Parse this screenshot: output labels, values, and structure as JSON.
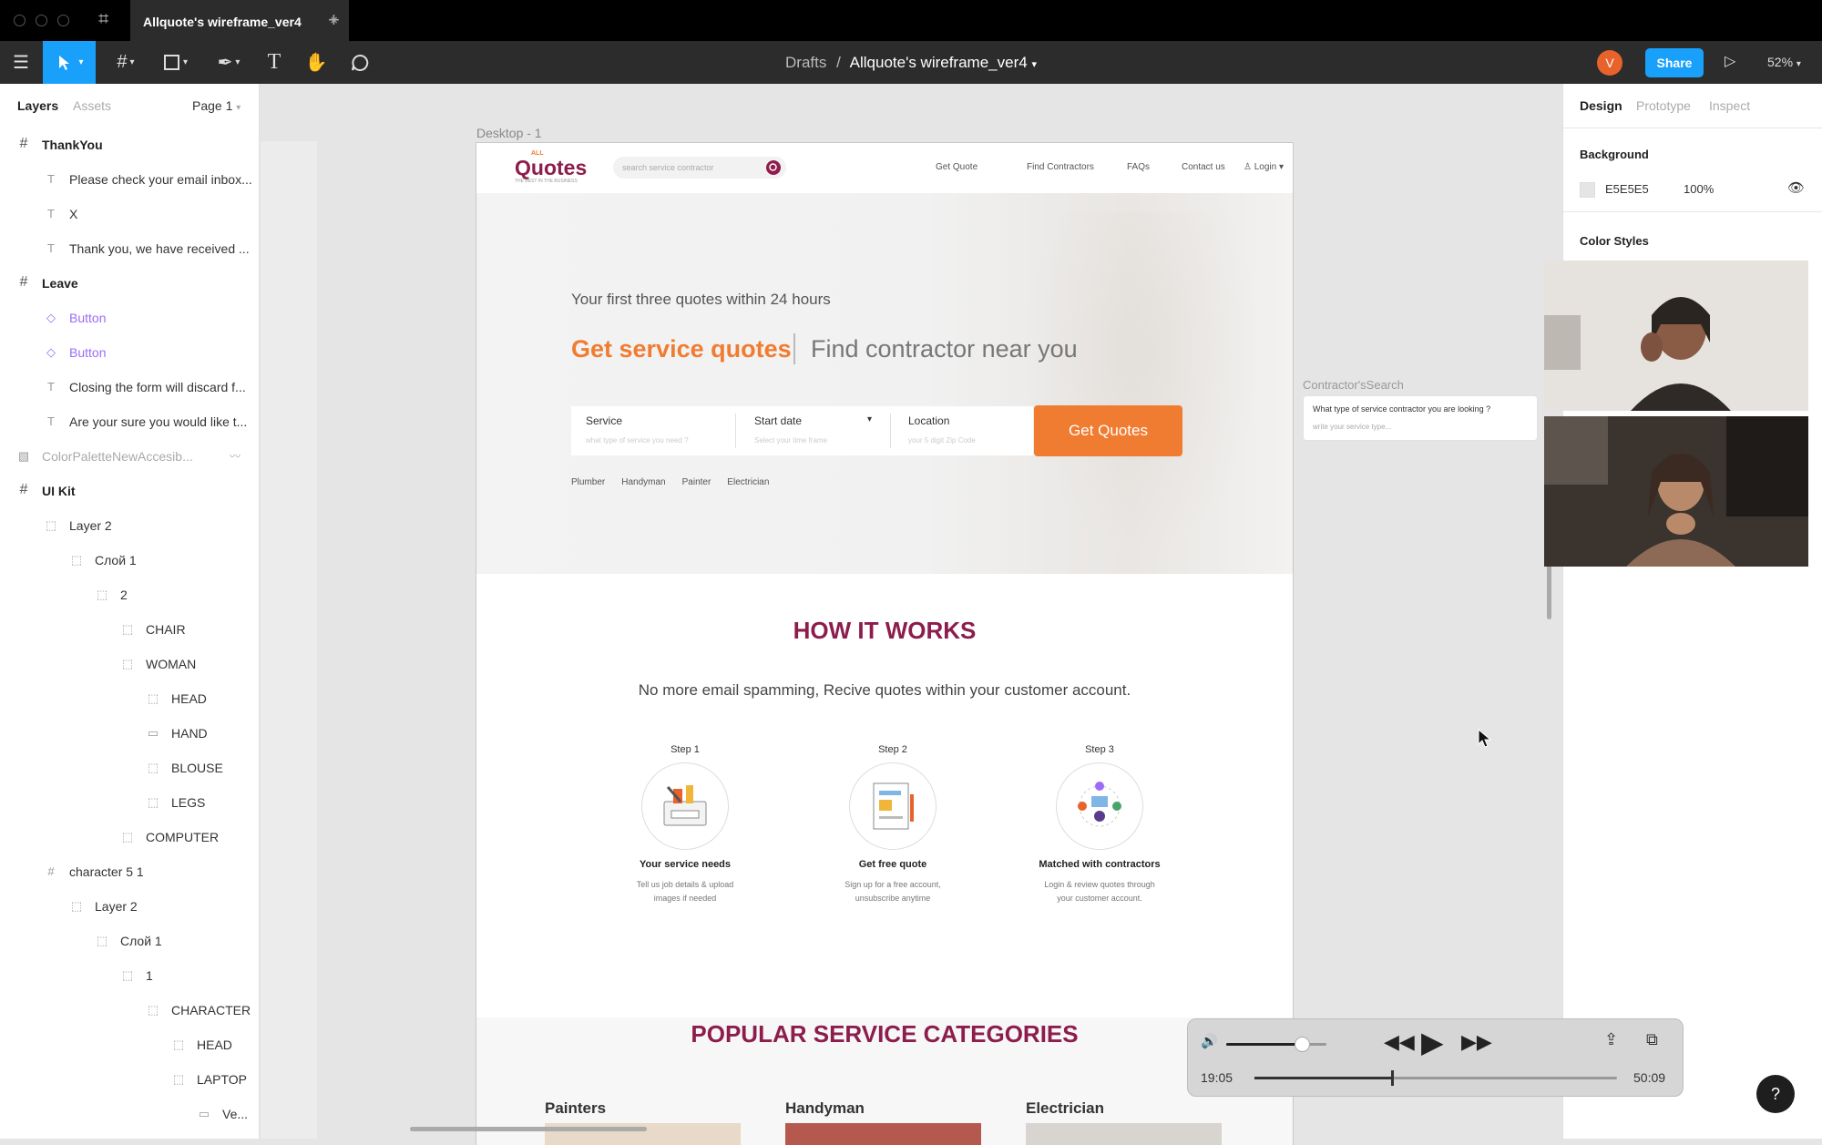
{
  "tab": {
    "title": "Allquote's wireframe_ver4",
    "close": "×",
    "new": "+"
  },
  "toolbar": {
    "breadcrumb_root": "Drafts",
    "breadcrumb_sep": "/",
    "file_name": "Allquote's wireframe_ver4",
    "avatar": "V",
    "share": "Share",
    "zoom": "52%"
  },
  "left_panel": {
    "tab_layers": "Layers",
    "tab_assets": "Assets",
    "page": "Page 1",
    "layers": [
      {
        "label": "ThankYou",
        "kind": "frame",
        "icon": "#",
        "indent": 0
      },
      {
        "label": "Please check your email inbox...",
        "kind": "text",
        "icon": "T",
        "indent": 1
      },
      {
        "label": "X",
        "kind": "text",
        "icon": "T",
        "indent": 1
      },
      {
        "label": "Thank you, we have received ...",
        "kind": "text",
        "icon": "T",
        "indent": 1
      },
      {
        "label": "Leave",
        "kind": "frame",
        "icon": "#",
        "indent": 0
      },
      {
        "label": "Button",
        "kind": "comp",
        "icon": "◇",
        "indent": 1
      },
      {
        "label": "Button",
        "kind": "comp",
        "icon": "◇",
        "indent": 1
      },
      {
        "label": "Closing the form will discard f...",
        "kind": "text",
        "icon": "T",
        "indent": 1
      },
      {
        "label": "Are your sure you would like t...",
        "kind": "text",
        "icon": "T",
        "indent": 1
      },
      {
        "label": "ColorPaletteNewAccesib...",
        "kind": "faded",
        "icon": "▧",
        "indent": 0
      },
      {
        "label": "UI Kit",
        "kind": "frame",
        "icon": "#",
        "indent": 0
      },
      {
        "label": "Layer 2",
        "kind": "group",
        "icon": "⬚",
        "indent": 1
      },
      {
        "label": "Слой 1",
        "kind": "group",
        "icon": "⬚",
        "indent": 2
      },
      {
        "label": "2",
        "kind": "group",
        "icon": "⬚",
        "indent": 3
      },
      {
        "label": "CHAIR",
        "kind": "group",
        "icon": "⬚",
        "indent": 4
      },
      {
        "label": "WOMAN",
        "kind": "group",
        "icon": "⬚",
        "indent": 4
      },
      {
        "label": "HEAD",
        "kind": "group",
        "icon": "⬚",
        "indent": 5
      },
      {
        "label": "HAND",
        "kind": "group",
        "icon": "▭",
        "indent": 5
      },
      {
        "label": "BLOUSE",
        "kind": "group",
        "icon": "⬚",
        "indent": 5
      },
      {
        "label": "LEGS",
        "kind": "group",
        "icon": "⬚",
        "indent": 5
      },
      {
        "label": "COMPUTER",
        "kind": "group",
        "icon": "⬚",
        "indent": 4
      },
      {
        "label": "character 5 1",
        "kind": "frame2",
        "icon": "#",
        "indent": 1
      },
      {
        "label": "Layer 2",
        "kind": "group",
        "icon": "⬚",
        "indent": 2
      },
      {
        "label": "Слой 1",
        "kind": "group",
        "icon": "⬚",
        "indent": 3
      },
      {
        "label": "1",
        "kind": "group",
        "icon": "⬚",
        "indent": 4
      },
      {
        "label": "CHARACTER",
        "kind": "group",
        "icon": "⬚",
        "indent": 5
      },
      {
        "label": "HEAD",
        "kind": "group",
        "icon": "⬚",
        "indent": 6
      },
      {
        "label": "LAPTOP",
        "kind": "group",
        "icon": "⬚",
        "indent": 6
      },
      {
        "label": "Ve...",
        "kind": "group",
        "icon": "▭",
        "indent": 7
      }
    ]
  },
  "right_panel": {
    "tab_design": "Design",
    "tab_prototype": "Prototype",
    "tab_inspect": "Inspect",
    "background_label": "Background",
    "bg_hex": "E5E5E5",
    "bg_opacity": "100%",
    "color_styles": "Color Styles"
  },
  "canvas": {
    "frame_label": "Desktop - 1",
    "side_frame_label": "Contractor'sSearch",
    "side_question": "What type of service contractor you are looking ?",
    "side_placeholder": "write your service type...",
    "logo_small": "ALL",
    "logo": "Quotes",
    "logo_tagline": "THE BEST IN THE BUSINESS",
    "nav_search_placeholder": "search service contractor",
    "nav_links": [
      "Get Quote",
      "Find Contractors",
      "FAQs",
      "Contact us",
      "Login"
    ],
    "hero_sub": "Your first three quotes within 24 hours",
    "hero_title_a": "Get service quotes",
    "hero_title_b": "Find contractor near you",
    "form_service_label": "Service",
    "form_service_ph": "what type of service you need ?",
    "form_date_label": "Start date",
    "form_date_ph": "Select your time frame",
    "form_loc_label": "Location",
    "form_loc_ph": "your 5 digit Zip Code",
    "form_button": "Get Quotes",
    "quick_tags": [
      "Plumber",
      "Handyman",
      "Painter",
      "Electrician"
    ],
    "how_title": "HOW IT WORKS",
    "how_sub": "No more email spamming, Recive quotes within your customer account.",
    "steps": [
      {
        "step": "Step 1",
        "title": "Your service needs",
        "desc1": "Tell us job details & upload",
        "desc2": "images if needed"
      },
      {
        "step": "Step 2",
        "title": "Get free quote",
        "desc1": "Sign up for a free account,",
        "desc2": "unsubscribe anytime"
      },
      {
        "step": "Step 3",
        "title": "Matched with contractors",
        "desc1": "Login & review quotes through",
        "desc2": "your customer account."
      }
    ],
    "popular_title": "POPULAR SERVICE CATEGORIES",
    "categories": [
      "Painters",
      "Handyman",
      "Electrician"
    ]
  },
  "video": {
    "elapsed": "19:05",
    "total": "50:09",
    "volume": 0.75,
    "progress": 0.38
  },
  "help": "?",
  "colors": {
    "accent_orange": "#f07c31",
    "brand_maroon": "#8c1d4d",
    "figma_blue": "#18a0fb",
    "dark_toolbar": "#2c2c2c"
  }
}
